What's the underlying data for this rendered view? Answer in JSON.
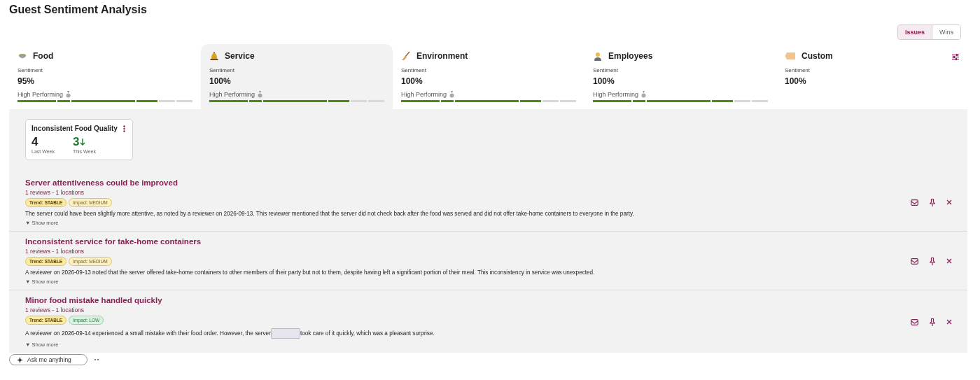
{
  "title": "Guest Sentiment Analysis",
  "view_toggle": [
    {
      "label": "Issues",
      "selected": true
    },
    {
      "label": "Wins",
      "selected": false
    }
  ],
  "categories": [
    {
      "kind": "bowl",
      "name": "Food",
      "sentiment_label": "Sentiment",
      "sentiment": "95%",
      "status": "High Performing",
      "level": 0.8,
      "selected": false
    },
    {
      "kind": "bell",
      "name": "Service",
      "sentiment_label": "Sentiment",
      "sentiment": "100%",
      "status": "High Performing",
      "level": 0.8,
      "selected": true
    },
    {
      "kind": "broom",
      "name": "Environment",
      "sentiment_label": "Sentiment",
      "sentiment": "100%",
      "status": "High Performing",
      "level": 0.8,
      "selected": false
    },
    {
      "kind": "person",
      "name": "Employees",
      "sentiment_label": "Sentiment",
      "sentiment": "100%",
      "status": "High Performing",
      "level": 0.8,
      "selected": false
    },
    {
      "kind": "tag",
      "name": "Custom",
      "sentiment_label": "Sentiment",
      "sentiment": "100%",
      "selected": false
    }
  ],
  "summary_card": {
    "title": "Inconsistent Food Quality",
    "last_value": "4",
    "last_label": "Last Week",
    "this_value": "3",
    "this_label": "This Week",
    "decreasing": true
  },
  "issues": [
    {
      "title": "Server attentiveness could be improved",
      "meta": "1 reviews - 1 locations",
      "trend": "Trend: STABLE",
      "impact": "Impact: MEDIUM",
      "kind": "medium",
      "description": "The server could have been slightly more attentive, as noted by a reviewer on 2026-09-13. This reviewer mentioned that the server did not check back after the food was served and did not offer take-home containers to everyone in the party.",
      "toggle": "▼ Show more"
    },
    {
      "title": "Inconsistent service for take-home containers",
      "meta": "1 reviews - 1 locations",
      "trend": "Trend: STABLE",
      "impact": "Impact: MEDIUM",
      "kind": "medium",
      "description": "A reviewer on 2026-09-13 noted that the server offered take-home containers to other members of their party but not to them, despite having left a significant portion of their meal. This inconsistency in service was unexpected.",
      "toggle": "▼ Show more"
    },
    {
      "title": "Minor food mistake handled quickly",
      "meta": "1 reviews - 1 locations",
      "trend": "Trend: STABLE",
      "impact": "Impact: LOW",
      "kind": "low",
      "description": "A reviewer on 2026-09-14 experienced a small mistake with their food order. However, the server",
      "description_continued": "took care of it quickly, which was a pleasant surprise.",
      "toggle": "▼ Show more"
    }
  ],
  "chat": {
    "placeholder": "Ask me anything"
  }
}
